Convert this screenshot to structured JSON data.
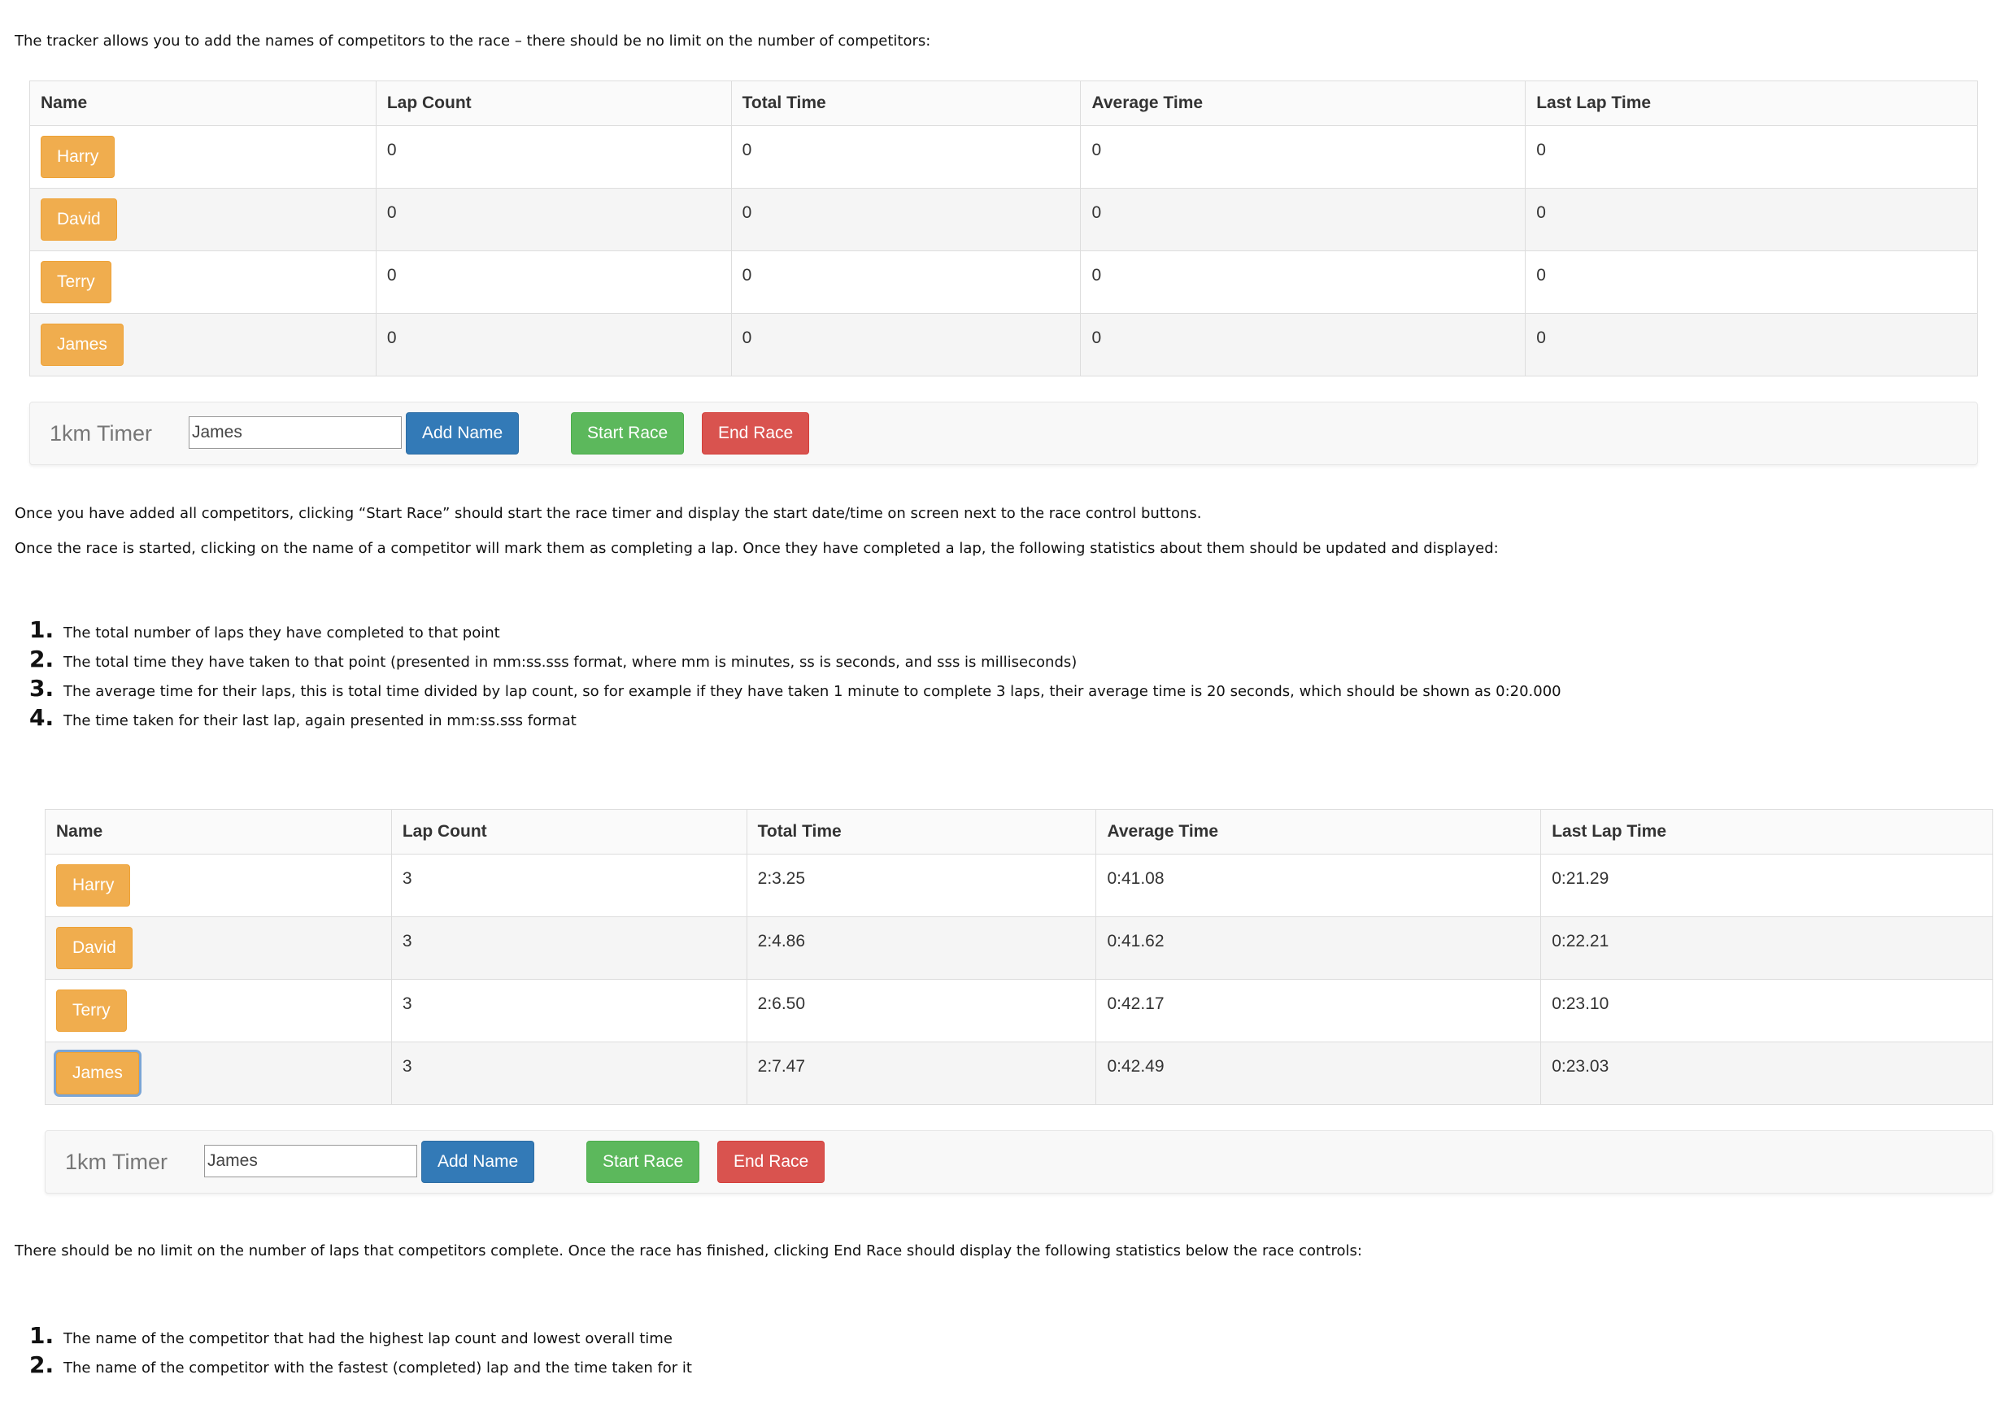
{
  "intro_text": "The tracker allows you to add the names of competitors to the race – there should be no limit on the number of competitors:",
  "columns": [
    "Name",
    "Lap Count",
    "Total Time",
    "Average Time",
    "Last Lap Time"
  ],
  "table1": {
    "rows": [
      {
        "name": "Harry",
        "lap_count": "0",
        "total_time": "0",
        "average_time": "0",
        "last_lap_time": "0"
      },
      {
        "name": "David",
        "lap_count": "0",
        "total_time": "0",
        "average_time": "0",
        "last_lap_time": "0"
      },
      {
        "name": "Terry",
        "lap_count": "0",
        "total_time": "0",
        "average_time": "0",
        "last_lap_time": "0"
      },
      {
        "name": "James",
        "lap_count": "0",
        "total_time": "0",
        "average_time": "0",
        "last_lap_time": "0"
      }
    ]
  },
  "controls": {
    "brand": "1km Timer",
    "input_value": "James",
    "add_name_label": "Add Name",
    "start_race_label": "Start Race",
    "end_race_label": "End Race"
  },
  "start_text": "Once you have added all competitors, clicking “Start Race” should start the race timer and display the start date/time on screen next to the race control buttons.",
  "lap_text": "Once the race is started, clicking on the name of a competitor will mark them as completing a lap. Once they have completed a lap, the following statistics about them should be updated and displayed:",
  "stats_list": [
    {
      "num": "1.",
      "text": "The total number of laps they have completed to that point"
    },
    {
      "num": "2.",
      "text": "The total time they have taken to that point (presented in mm:ss.sss format, where mm is minutes, ss is seconds, and sss is milliseconds)"
    },
    {
      "num": "3.",
      "text": "The average time for their laps, this is total time divided by lap count, so for example if they have taken 1 minute to complete 3 laps, their average time is 20 seconds, which should be shown as 0:20.000"
    },
    {
      "num": "4.",
      "text": "The time taken for their last lap, again presented in mm:ss.sss format"
    }
  ],
  "table2": {
    "rows": [
      {
        "name": "Harry",
        "lap_count": "3",
        "total_time": "2:3.25",
        "average_time": "0:41.08",
        "last_lap_time": "0:21.29"
      },
      {
        "name": "David",
        "lap_count": "3",
        "total_time": "2:4.86",
        "average_time": "0:41.62",
        "last_lap_time": "0:22.21"
      },
      {
        "name": "Terry",
        "lap_count": "3",
        "total_time": "2:6.50",
        "average_time": "0:42.17",
        "last_lap_time": "0:23.10"
      },
      {
        "name": "James",
        "lap_count": "3",
        "total_time": "2:7.47",
        "average_time": "0:42.49",
        "last_lap_time": "0:23.03"
      }
    ]
  },
  "end_text": "There should be no limit on the number of laps that competitors complete. Once the race has finished, clicking End Race should display the following statistics below the race controls:",
  "end_list": [
    {
      "num": "1.",
      "text": "The name of the competitor that had the highest lap count and lowest overall time"
    },
    {
      "num": "2.",
      "text": "The name of the competitor with the fastest (completed) lap and the time taken for it"
    }
  ]
}
